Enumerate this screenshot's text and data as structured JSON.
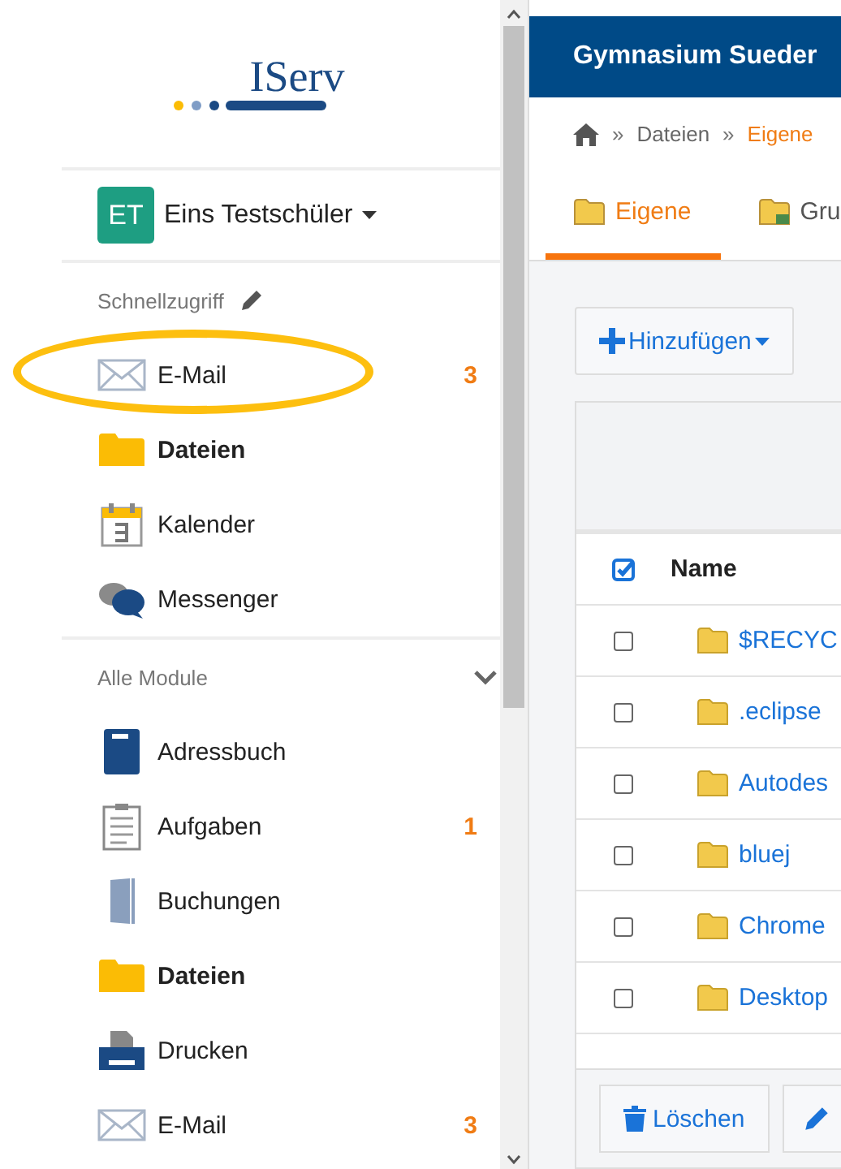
{
  "sidebar": {
    "logo": "IServ",
    "user": {
      "initials": "ET",
      "name": "Eins Testschüler"
    },
    "quick_access": {
      "title": "Schnellzugriff",
      "items": [
        {
          "kind": "mail",
          "label": "E-Mail",
          "badge": "3",
          "active": false,
          "highlighted": true
        },
        {
          "kind": "folder",
          "label": "Dateien",
          "active": true,
          "highlighted": false
        },
        {
          "kind": "calendar",
          "label": "Kalender",
          "active": false,
          "highlighted": false
        },
        {
          "kind": "chat",
          "label": "Messenger",
          "active": false,
          "highlighted": false
        }
      ]
    },
    "modules": {
      "title": "Alle Module",
      "expanded": true,
      "items": [
        {
          "kind": "book",
          "label": "Adressbuch",
          "active": false
        },
        {
          "kind": "clipboard",
          "label": "Aufgaben",
          "badge": "1",
          "active": false
        },
        {
          "kind": "door",
          "label": "Buchungen",
          "active": false
        },
        {
          "kind": "folder",
          "label": "Dateien",
          "active": true
        },
        {
          "kind": "printer",
          "label": "Drucken",
          "active": false
        },
        {
          "kind": "mail",
          "label": "E-Mail",
          "badge": "3",
          "active": false
        }
      ]
    }
  },
  "header": {
    "title": "Gymnasium Sueder"
  },
  "breadcrumb": [
    {
      "label": "Dateien",
      "selected": false
    },
    {
      "label": "Eigene",
      "selected": true
    }
  ],
  "breadcrumb_separators": [
    "»",
    "»"
  ],
  "tabs": [
    {
      "label": "Eigene",
      "selected": true
    },
    {
      "label": "Gru",
      "selected": false
    }
  ],
  "add_button": "Hinzufügen",
  "table": {
    "select_all": true,
    "columns": [
      "Name"
    ],
    "rows": [
      {
        "name": "$RECYC",
        "checked": false
      },
      {
        "name": ".eclipse",
        "checked": false
      },
      {
        "name": "Autodes",
        "checked": false
      },
      {
        "name": "bluej",
        "checked": false
      },
      {
        "name": "Chrome",
        "checked": false
      },
      {
        "name": "Desktop",
        "checked": false
      }
    ]
  },
  "footer": {
    "delete_button": "Löschen"
  }
}
